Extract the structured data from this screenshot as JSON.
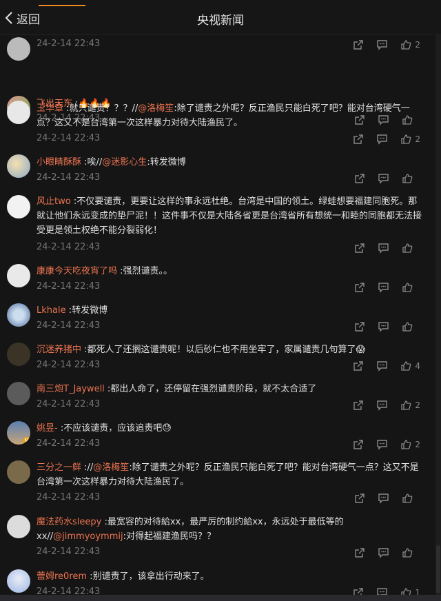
{
  "header": {
    "back_label": "返回",
    "title": "央视新闻"
  },
  "colors": {
    "accent": "#f28a22",
    "username": "#eb7350"
  },
  "comments": [
    {
      "user": "",
      "text": "",
      "time": "24-2-14 22:43",
      "like_count": "2"
    },
    {
      "user": "飞出天东",
      "text": " :",
      "emoji": "🔥🔥🔥",
      "time": "24-2-14 22:43",
      "like_count": ""
    },
    {
      "user": "玉华章",
      "text_pre": " :就只谴责？？？//",
      "mention": "@洛梅笙",
      "text_post": ":除了谴责之外呢？反正渔民只能白死了吧？能对台湾硬气一点？这又不是台湾第一次这样暴力对待大陆渔民了。",
      "time": "24-2-14 22:43",
      "like_count": "2"
    },
    {
      "user": "小眼睛酥酥",
      "text_pre": " :唉//",
      "mention": "@迷影心生",
      "text_post": ":转发微博",
      "time": "24-2-14 22:43",
      "like_count": ""
    },
    {
      "user": "风止two",
      "text": " :不仅要谴责，更要让这样的事永远杜绝。台湾是中国的领土。绿蛙想要福建同胞死。那就让他们永远变成的垫尸泥！！这件事不仅是大陆各省更是台湾省所有想统一和睦的同胞都无法接受更是领土权绝不能分裂弱化！",
      "time": "24-2-14 22:43",
      "like_count": ""
    },
    {
      "user": "康康今天吃夜宵了吗",
      "text": " :强烈谴责。。",
      "time": "24-2-14 22:43",
      "like_count": ""
    },
    {
      "user": "Lkhale",
      "text": " :转发微博",
      "time": "24-2-14 22:43",
      "like_count": ""
    },
    {
      "user": "沉迷养猪中",
      "text": " :都死人了还搁这谴责呢！以后砂仁也不用坐牢了，家属谴责几句算了",
      "emoji": "😱",
      "time": "24-2-14 22:43",
      "like_count": "4"
    },
    {
      "user": "南三炮T_Jaywell",
      "text": " :都出人命了，还停留在强烈谴责阶段，就不太合适了",
      "time": "24-2-14 22:43",
      "like_count": "2"
    },
    {
      "user": "姚昱-",
      "text": " :不应该谴责，应该追责吧",
      "emoji": "😓",
      "time": "24-2-14 22:43",
      "like_count": "2"
    },
    {
      "user": "三分之一鲜",
      "text_pre": " ://",
      "mention": "@洛梅笙",
      "text_post": ":除了谴责之外呢？反正渔民只能白死了吧？能对台湾硬气一点？这又不是台湾第一次这样暴力对待大陆渔民了。",
      "time": "24-2-14 22:43",
      "like_count": ""
    },
    {
      "user": "魔法药水sleepy",
      "text_pre": " :最宽容的对待給xx，最严厉的制约給xx，永远处于最低等的xx//",
      "mention": "@jimmyoymmij",
      "text_post": ":对得起福建渔民吗？？",
      "time": "24-2-14 22:43",
      "like_count": ""
    },
    {
      "user": "蕾姆re0rem",
      "text": " :别谴责了，该拿出行动来了。",
      "time": "24-2-14 22:43",
      "like_count": "1"
    }
  ],
  "icons": {
    "share": "share-icon",
    "comment": "comment-icon",
    "like": "thumbs-up-icon",
    "back": "chevron-left-icon"
  }
}
